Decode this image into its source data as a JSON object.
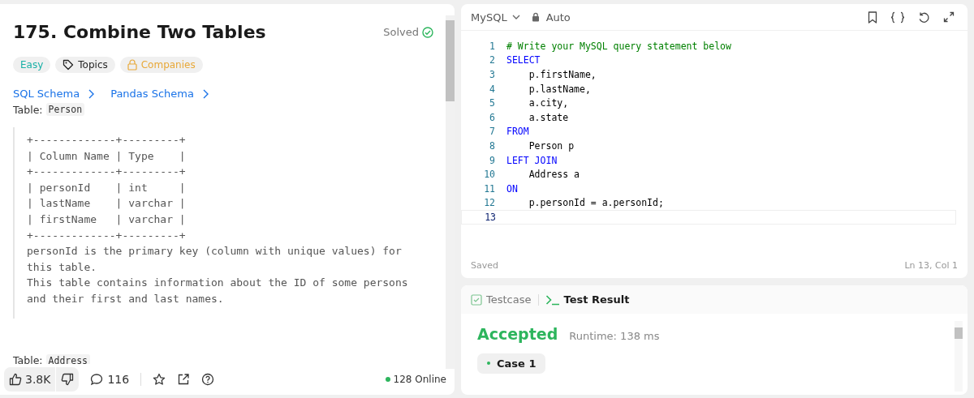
{
  "problem": {
    "title": "175. Combine Two Tables",
    "status": "Solved",
    "tags": [
      {
        "kind": "difficulty",
        "label": "Easy"
      },
      {
        "kind": "topics",
        "label": "Topics"
      },
      {
        "kind": "companies",
        "label": "Companies"
      }
    ],
    "schema_links": [
      "SQL Schema",
      "Pandas Schema"
    ],
    "table_label": "Table:",
    "table_name": "Person",
    "block_lines": [
      "+-------------+---------+",
      "| Column Name | Type    |",
      "+-------------+---------+",
      "| personId    | int     |",
      "| lastName    | varchar |",
      "| firstName   | varchar |",
      "+-------------+---------+",
      "personId is the primary key (column with unique values) for",
      "this table.",
      "This table contains information about the ID of some persons",
      "and their first and last names."
    ],
    "next_table_label": "Table:",
    "next_table_name": "Address"
  },
  "footer": {
    "likes": "3.8K",
    "comments": "116",
    "online": "128 Online"
  },
  "editor": {
    "language": "MySQL",
    "mode": "Auto",
    "lines": [
      {
        "number": "1",
        "tokens": [
          {
            "kind": "comment",
            "text": "# Write your MySQL query statement below"
          }
        ]
      },
      {
        "number": "2",
        "tokens": [
          {
            "kind": "keyword",
            "text": "SELECT"
          }
        ]
      },
      {
        "number": "3",
        "tokens": [
          {
            "kind": "plain",
            "text": "    p.firstName,"
          }
        ]
      },
      {
        "number": "4",
        "tokens": [
          {
            "kind": "plain",
            "text": "    p.lastName,"
          }
        ]
      },
      {
        "number": "5",
        "tokens": [
          {
            "kind": "plain",
            "text": "    a.city,"
          }
        ]
      },
      {
        "number": "6",
        "tokens": [
          {
            "kind": "plain",
            "text": "    a.state"
          }
        ]
      },
      {
        "number": "7",
        "tokens": [
          {
            "kind": "keyword",
            "text": "FROM"
          }
        ]
      },
      {
        "number": "8",
        "tokens": [
          {
            "kind": "plain",
            "text": "    Person p"
          }
        ]
      },
      {
        "number": "9",
        "tokens": [
          {
            "kind": "keyword",
            "text": "LEFT JOIN"
          }
        ]
      },
      {
        "number": "10",
        "tokens": [
          {
            "kind": "plain",
            "text": "    Address a"
          }
        ]
      },
      {
        "number": "11",
        "tokens": [
          {
            "kind": "keyword",
            "text": "ON"
          }
        ]
      },
      {
        "number": "12",
        "tokens": [
          {
            "kind": "plain",
            "text": "    p.personId = a.personId;"
          }
        ]
      },
      {
        "number": "13"
      }
    ],
    "saved": "Saved",
    "cursor": "Ln 13, Col 1"
  },
  "results": {
    "tabs": [
      {
        "label": "Testcase",
        "selected": false
      },
      {
        "label": "Test Result",
        "selected": true
      }
    ],
    "verdict": "Accepted",
    "runtime": "Runtime: 138 ms",
    "cases": [
      {
        "label": "Case 1",
        "selected": true
      }
    ]
  }
}
